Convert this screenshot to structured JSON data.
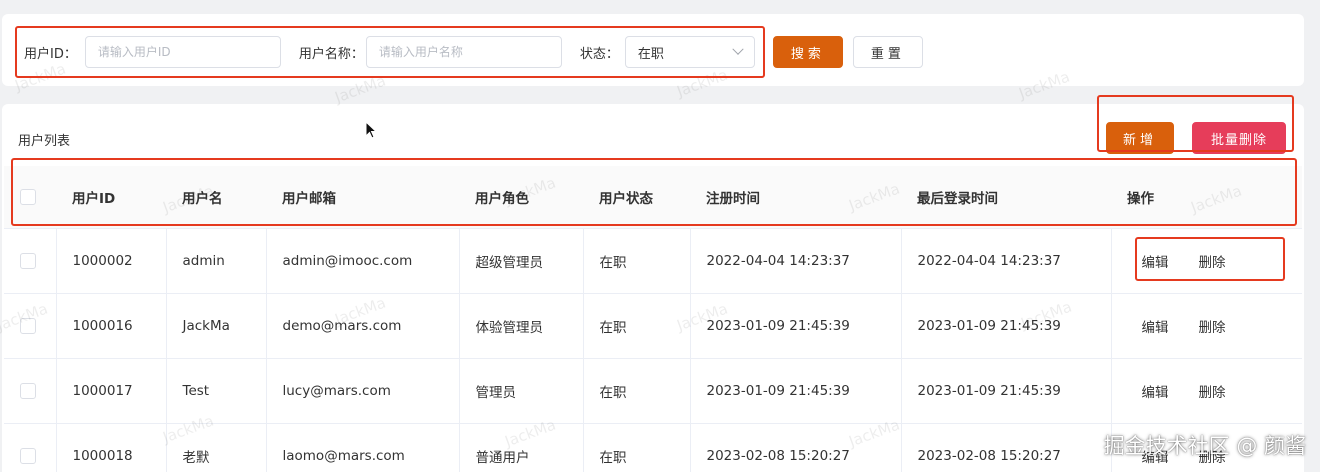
{
  "search": {
    "user_id_label": "用户ID：",
    "user_id_placeholder": "请输入用户ID",
    "user_name_label": "用户名称：",
    "user_name_placeholder": "请输入用户名称",
    "status_label": "状态：",
    "status_value": "在职",
    "search_button": "搜索",
    "reset_button": "重置"
  },
  "list": {
    "title": "用户列表",
    "add_button": "新增",
    "batch_delete_button": "批量删除",
    "columns": [
      "用户ID",
      "用户名",
      "用户邮箱",
      "用户角色",
      "用户状态",
      "注册时间",
      "最后登录时间",
      "操作"
    ],
    "rows": [
      {
        "id": "1000002",
        "name": "admin",
        "email": "admin@imooc.com",
        "role": "超级管理员",
        "status": "在职",
        "created": "2022-04-04 14:23:37",
        "last_login": "2022-04-04 14:23:37"
      },
      {
        "id": "1000016",
        "name": "JackMa",
        "email": "demo@mars.com",
        "role": "体验管理员",
        "status": "在职",
        "created": "2023-01-09 21:45:39",
        "last_login": "2023-01-09 21:45:39"
      },
      {
        "id": "1000017",
        "name": "Test",
        "email": "lucy@mars.com",
        "role": "管理员",
        "status": "在职",
        "created": "2023-01-09 21:45:39",
        "last_login": "2023-01-09 21:45:39"
      },
      {
        "id": "1000018",
        "name": "老默",
        "email": "laomo@mars.com",
        "role": "普通用户",
        "status": "在职",
        "created": "2023-02-08 15:20:27",
        "last_login": "2023-02-08 15:20:27"
      }
    ],
    "edit_label": "编辑",
    "delete_label": "删除"
  },
  "watermark_text": "JackMa",
  "credit": "掘金技术社区 @ 颜酱",
  "colors": {
    "primary": "#d9600c",
    "danger": "#e63d5a",
    "annotation": "#e53a1f"
  }
}
